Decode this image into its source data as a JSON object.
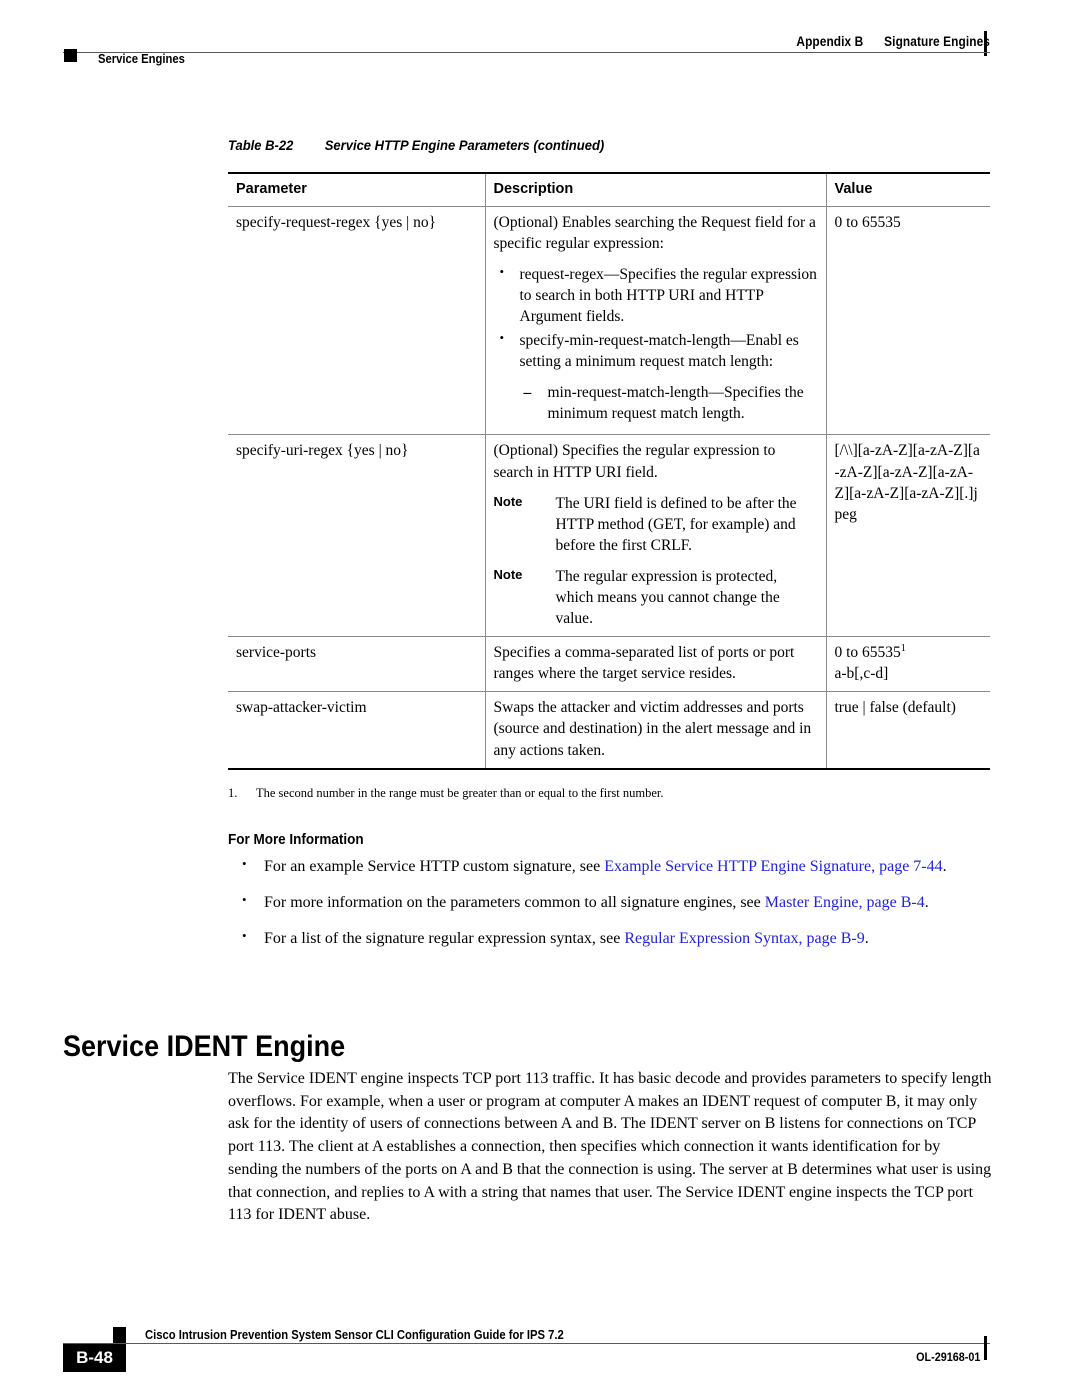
{
  "header": {
    "appendix": "Appendix B",
    "chapter": "Signature Engines",
    "section_label": "Service Engines"
  },
  "table": {
    "caption_number": "Table B-22",
    "caption_title": "Service HTTP Engine Parameters (continued)",
    "columns": [
      "Parameter",
      "Description",
      "Value"
    ],
    "rows": [
      {
        "parameter": "specify-request-regex {yes | no}",
        "description_intro": "(Optional) Enables searching the Request field for a specific regular expression:",
        "bullets": [
          {
            "text": "request-regex—Specifies the regular expression to search in both HTTP URI and HTTP Argument fields.",
            "sub": []
          },
          {
            "text": "specify-min-request-match-length—Enabl es setting a minimum request match length:",
            "sub": [
              "min-request-match-length—Specifies the minimum request match length."
            ]
          }
        ],
        "value": "0 to 65535"
      },
      {
        "parameter": "specify-uri-regex {yes | no}",
        "description_intro": "(Optional) Specifies the regular expression to search in HTTP URI field.",
        "notes": [
          {
            "label": "Note",
            "text": "The URI field is defined to be after the HTTP method (GET, for example) and before the first CRLF."
          },
          {
            "label": "Note",
            "text": "The regular expression is protected, which means you cannot change the value."
          }
        ],
        "value": "[/\\\\][a-zA-Z][a-zA-Z][a-zA-Z][a-zA-Z][a-zA-Z][a-zA-Z][a-zA-Z][.]jpeg"
      },
      {
        "parameter": "service-ports",
        "description_intro": "Specifies a comma-separated list of ports or port ranges where the target service resides.",
        "value_line1": "0 to 65535",
        "value_superscript": "1",
        "value_line2": "a-b[,c-d]"
      },
      {
        "parameter": "swap-attacker-victim",
        "description_intro": "Swaps the attacker and victim addresses and ports (source and destination) in the alert message and in any actions taken.",
        "value": "true | false (default)"
      }
    ]
  },
  "footnote": {
    "number": "1.",
    "text": "The second number in the range must be greater than or equal to the first number."
  },
  "for_more_information": {
    "heading": "For More Information",
    "items": [
      {
        "lead": "For an example Service HTTP custom signature, see ",
        "link": "Example Service HTTP Engine Signature, page 7-44",
        "trail": "."
      },
      {
        "lead": "For more information on the parameters common to all signature engines, see ",
        "link": "Master Engine, page B-4",
        "trail": "."
      },
      {
        "lead": "For a list of the signature regular expression syntax, see ",
        "link": "Regular Expression Syntax, page B-9",
        "trail": "."
      }
    ]
  },
  "section": {
    "heading": "Service IDENT Engine",
    "paragraph": "The Service IDENT engine inspects TCP port 113 traffic. It has basic decode and provides parameters to specify length overflows. For example, when a user or program at computer A makes an IDENT request of computer B, it may only ask for the identity of users of connections between A and B. The IDENT server on B listens for connections on TCP port 113. The client at A establishes a connection, then specifies which connection it wants identification for by sending the numbers of the ports on A and B that the connection is using. The server at B determines what user is using that connection, and replies to A with a string that names that user. The Service IDENT engine inspects the TCP port 113 for IDENT abuse."
  },
  "footer": {
    "page_number": "B-48",
    "guide_title": "Cisco Intrusion Prevention System Sensor CLI Configuration Guide for IPS 7.2",
    "doc_id": "OL-29168-01"
  },
  "colors": {
    "link": "#2222dd",
    "rule": "#5a5a5a",
    "text": "#000000"
  }
}
